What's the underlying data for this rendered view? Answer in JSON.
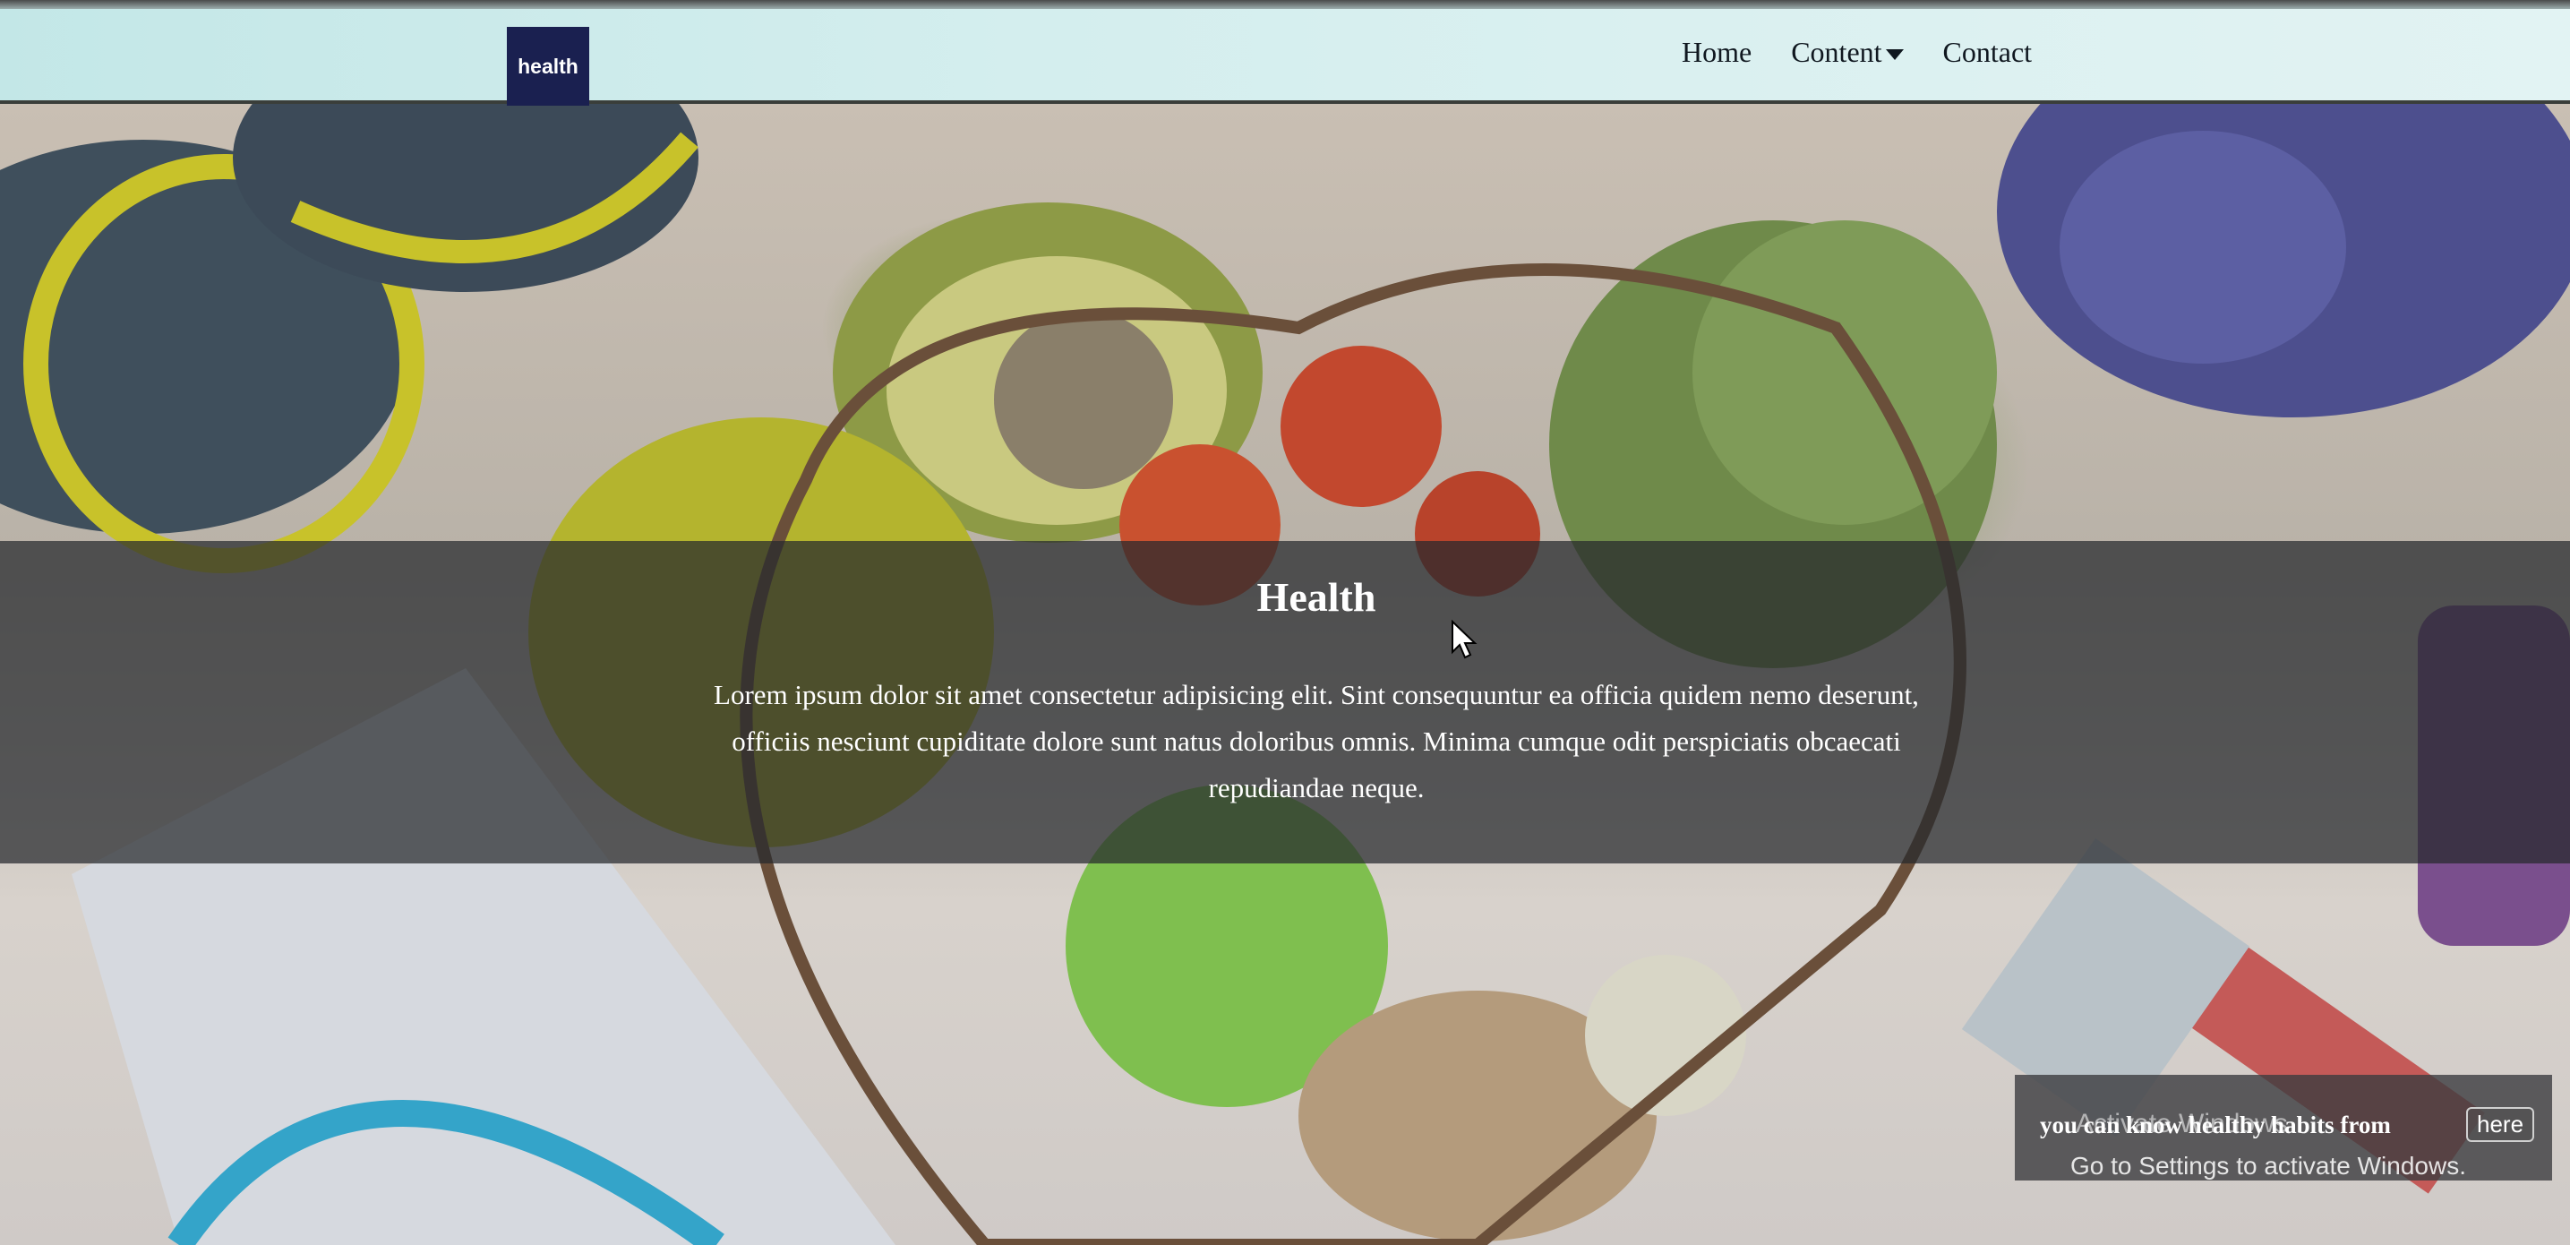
{
  "navbar": {
    "brand": "health",
    "links": {
      "home": "Home",
      "content": "Content",
      "contact": "Contact"
    }
  },
  "hero": {
    "title": "Health",
    "text": "Lorem ipsum dolor sit amet consectetur adipisicing elit. Sint consequuntur ea officia quidem nemo deserunt, officiis nesciunt cupiditate dolore sunt natus doloribus omnis. Minima cumque odit perspiciatis obcaecati repudiandae neque."
  },
  "toast": {
    "text": "you can know healthy habits from",
    "link": "here"
  },
  "watermark": {
    "title": "Activate Windows",
    "subtitle": "Go to Settings to activate Windows."
  },
  "colors": {
    "navbar_bg": "#d4eeee",
    "brand_bg": "#1a2050",
    "caption_overlay": "#26282c"
  }
}
